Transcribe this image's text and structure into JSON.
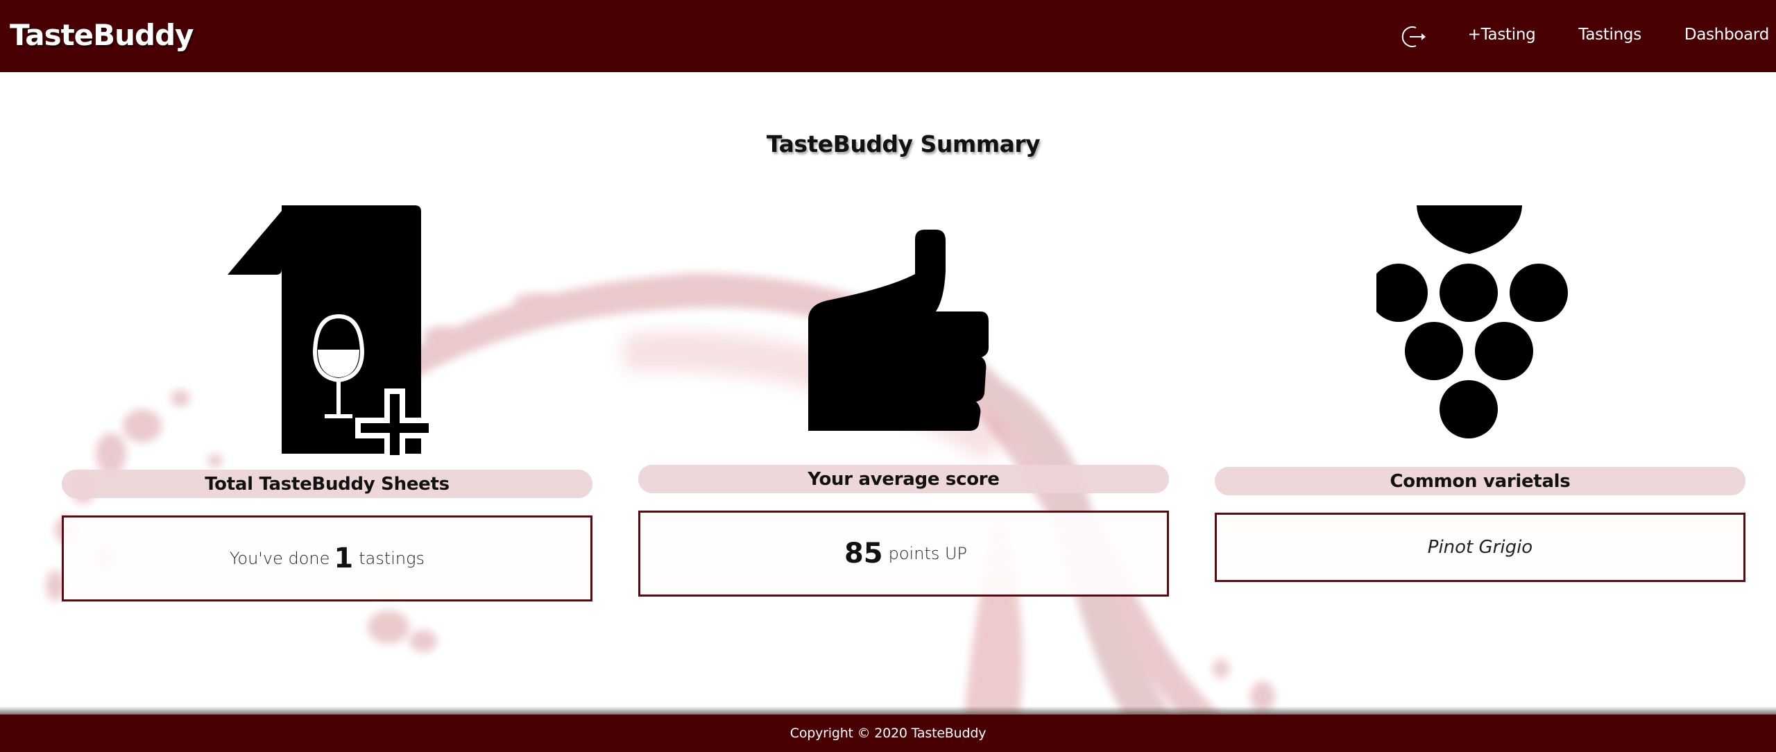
{
  "navbar": {
    "brand": "TasteBuddy",
    "logout_icon": "logout-icon",
    "links": [
      "+Tasting",
      "Tastings",
      "Dashboard"
    ]
  },
  "main": {
    "title": "TasteBuddy Summary",
    "cards": [
      {
        "icon": "wine-sheet-add-icon",
        "label": "Total TasteBuddy Sheets",
        "prefix": "You've done",
        "number": "1",
        "suffix": "tastings"
      },
      {
        "icon": "thumbs-up-icon",
        "label": "Your average score",
        "number": "85",
        "suffix": "points UP"
      },
      {
        "icon": "grapes-icon",
        "label": "Common varietals",
        "value": "Pinot Grigio"
      }
    ]
  },
  "footer": {
    "copyright": "Copyright © 2020 TasteBuddy"
  },
  "colors": {
    "brand_dark": "#490003",
    "label_bg": "#edd4d6",
    "box_border": "#5a0a10",
    "splash": "#a3101e"
  }
}
